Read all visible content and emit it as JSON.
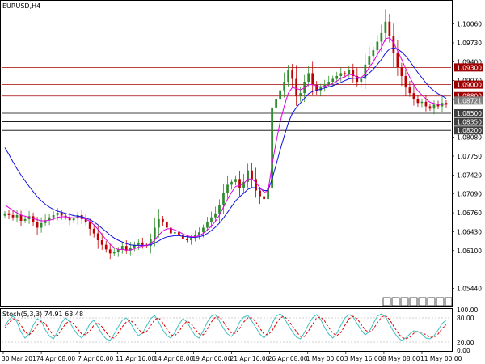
{
  "window": {
    "title": "EURUSD,H4"
  },
  "colors": {
    "bull": "#2e8b2e",
    "bear": "#c00000",
    "ma_fast": "#e000e0",
    "ma_slow": "#1010e0",
    "resistance": "#a00000",
    "support": "#000000",
    "stoch_main": "#40c0c0",
    "stoch_signal": "#e00000",
    "grid": "#c0c0c0"
  },
  "chart_data": [
    {
      "type": "candlestick",
      "title": "EURUSD,H4",
      "ylim": [
        1.0515,
        1.1045
      ],
      "y_ticks": [
        "1.10060",
        "1.09730",
        "1.09400",
        "1.09070",
        "1.08740",
        "1.08080",
        "1.07750",
        "1.07420",
        "1.07090",
        "1.06760",
        "1.06430",
        "1.06100",
        "1.05440"
      ],
      "x_ticks": [
        "30 Mar 2017",
        "4 Apr 08:00",
        "7 Apr 00:00",
        "11 Apr 16:00",
        "14 Apr 08:00",
        "19 Apr 00:00",
        "21 Apr 16:00",
        "26 Apr 08:00",
        "1 May 00:00",
        "3 May 16:00",
        "8 May 08:00",
        "11 May 00:00"
      ],
      "series": [
        {
          "name": "close",
          "values": [
            1.0675,
            1.0672,
            1.0668,
            1.0672,
            1.0662,
            1.0665,
            1.067,
            1.066,
            1.065,
            1.0658,
            1.0663,
            1.0668,
            1.0672,
            1.0676,
            1.0671,
            1.0668,
            1.0663,
            1.0666,
            1.0672,
            1.0665,
            1.0659,
            1.0648,
            1.064,
            1.0628,
            1.062,
            1.0612,
            1.0605,
            1.0608,
            1.0612,
            1.0618,
            1.061,
            1.0615,
            1.062,
            1.0624,
            1.062,
            1.0618,
            1.063,
            1.065,
            1.0665,
            1.066,
            1.065,
            1.064,
            1.0642,
            1.0638,
            1.063,
            1.0628,
            1.0632,
            1.0638,
            1.0642,
            1.065,
            1.066,
            1.0668,
            1.0675,
            1.069,
            1.071,
            1.0725,
            1.073,
            1.0735,
            1.072,
            1.073,
            1.075,
            1.0735,
            1.0715,
            1.0705,
            1.07,
            1.072,
            1.086,
            1.0875,
            1.089,
            1.0905,
            1.0925,
            1.091,
            1.088,
            1.0885,
            1.0905,
            1.092,
            1.09,
            1.089,
            1.0895,
            1.09,
            1.0905,
            1.091,
            1.0915,
            1.092,
            1.0918,
            1.0925,
            1.0915,
            1.0905,
            1.091,
            1.0935,
            1.095,
            1.096,
            1.0975,
            1.099,
            1.101,
            1.0985,
            1.0955,
            1.093,
            1.0915,
            1.0895,
            1.0885,
            1.0875,
            1.0868,
            1.087,
            1.0862,
            1.0858,
            1.0865,
            1.0862,
            1.0868,
            1.0865
          ]
        },
        {
          "name": "MA fast",
          "values": [
            1.069,
            1.0685,
            1.068,
            1.0676,
            1.0672,
            1.067,
            1.0668,
            1.0666,
            1.0664,
            1.0662,
            1.0662,
            1.0663,
            1.0665,
            1.0668,
            1.0669,
            1.0669,
            1.0668,
            1.0667,
            1.0668,
            1.0667,
            1.0665,
            1.0661,
            1.0655,
            1.0647,
            1.0638,
            1.0629,
            1.0621,
            1.0615,
            1.0612,
            1.0612,
            1.0611,
            1.0611,
            1.0613,
            1.0616,
            1.0618,
            1.0619,
            1.0622,
            1.0628,
            1.0637,
            1.0644,
            1.0648,
            1.0648,
            1.0646,
            1.0643,
            1.0639,
            1.0636,
            1.0634,
            1.0634,
            1.0636,
            1.064,
            1.0646,
            1.0653,
            1.0661,
            1.0672,
            1.0686,
            1.07,
            1.0712,
            1.0722,
            1.0724,
            1.0727,
            1.0735,
            1.0735,
            1.0729,
            1.072,
            1.0712,
            1.0714,
            1.076,
            1.08,
            1.0835,
            1.0862,
            1.0885,
            1.0895,
            1.0893,
            1.0891,
            1.0894,
            1.09,
            1.09,
            1.0897,
            1.0896,
            1.0897,
            1.0899,
            1.0902,
            1.0906,
            1.0911,
            1.0914,
            1.0918,
            1.0917,
            1.0913,
            1.0912,
            1.0919,
            1.093,
            1.094,
            1.0952,
            1.0965,
            1.098,
            1.0982,
            1.0973,
            1.0959,
            1.0944,
            1.0928,
            1.0913,
            1.09,
            1.0889,
            1.0882,
            1.0875,
            1.0869,
            1.0867,
            1.0865,
            1.0866,
            1.0866
          ]
        },
        {
          "name": "MA slow",
          "values": [
            1.079,
            1.0778,
            1.0765,
            1.0753,
            1.0742,
            1.0732,
            1.0722,
            1.0713,
            1.0704,
            1.0697,
            1.0691,
            1.0686,
            1.0682,
            1.0679,
            1.0677,
            1.0675,
            1.0673,
            1.0671,
            1.067,
            1.0669,
            1.0667,
            1.0664,
            1.066,
            1.0655,
            1.0649,
            1.0643,
            1.0637,
            1.0632,
            1.0628,
            1.0625,
            1.0622,
            1.062,
            1.0619,
            1.0619,
            1.0619,
            1.0619,
            1.062,
            1.0623,
            1.0627,
            1.0631,
            1.0634,
            1.0635,
            1.0636,
            1.0636,
            1.0635,
            1.0634,
            1.0633,
            1.0633,
            1.0634,
            1.0636,
            1.064,
            1.0645,
            1.0651,
            1.0658,
            1.0667,
            1.0677,
            1.0687,
            1.0697,
            1.0704,
            1.071,
            1.0717,
            1.072,
            1.072,
            1.0718,
            1.0715,
            1.0715,
            1.0735,
            1.076,
            1.0786,
            1.081,
            1.0833,
            1.085,
            1.086,
            1.0868,
            1.0876,
            1.0884,
            1.0888,
            1.089,
            1.0892,
            1.0894,
            1.0896,
            1.0898,
            1.0901,
            1.0904,
            1.0907,
            1.091,
            1.0911,
            1.0911,
            1.0911,
            1.0914,
            1.092,
            1.0927,
            1.0935,
            1.0944,
            1.0955,
            1.0962,
            1.0964,
            1.0962,
            1.0957,
            1.095,
            1.0941,
            1.0931,
            1.0921,
            1.0912,
            1.0903,
            1.0895,
            1.0889,
            1.0884,
            1.088,
            1.0876
          ]
        }
      ],
      "levels": [
        {
          "value": 1.093,
          "label": "1.09300",
          "kind": "resistance"
        },
        {
          "value": 1.09,
          "label": "1.09000",
          "kind": "resistance"
        },
        {
          "value": 1.088,
          "label": "1.08800",
          "kind": "resistance"
        },
        {
          "value": 1.085,
          "label": "1.08500",
          "kind": "support"
        },
        {
          "value": 1.0835,
          "label": "1.08350",
          "kind": "support"
        },
        {
          "value": 1.082,
          "label": "1.08200",
          "kind": "support"
        }
      ],
      "current_price": "1.08721"
    },
    {
      "type": "line",
      "title": "Stoch(5,3,3) 74.91 63.48",
      "ylim": [
        0,
        100
      ],
      "y_ticks": [
        "100.00",
        "80.00",
        "20.00",
        "0.00"
      ],
      "series": [
        {
          "name": "Stoch main",
          "values": [
            60,
            75,
            85,
            70,
            45,
            30,
            40,
            62,
            78,
            72,
            50,
            35,
            28,
            45,
            68,
            80,
            70,
            52,
            38,
            30,
            45,
            66,
            74,
            58,
            40,
            28,
            24,
            40,
            58,
            74,
            80,
            68,
            50,
            36,
            42,
            60,
            78,
            86,
            70,
            50,
            36,
            30,
            44,
            64,
            78,
            70,
            52,
            36,
            30,
            48,
            70,
            84,
            88,
            72,
            54,
            40,
            34,
            48,
            70,
            82,
            86,
            72,
            56,
            40,
            30,
            44,
            66,
            84,
            90,
            80,
            62,
            46,
            32,
            28,
            44,
            64,
            80,
            88,
            76,
            56,
            40,
            30,
            42,
            62,
            80,
            88,
            82,
            66,
            50,
            38,
            46,
            66,
            84,
            90,
            82,
            64,
            46,
            32,
            24,
            30,
            40,
            48,
            46,
            40,
            30,
            28,
            36,
            50,
            66,
            75
          ]
        },
        {
          "name": "Stoch signal",
          "values": [
            55,
            68,
            78,
            76,
            62,
            45,
            38,
            48,
            62,
            72,
            66,
            50,
            36,
            36,
            50,
            66,
            72,
            66,
            52,
            40,
            38,
            48,
            62,
            68,
            58,
            44,
            32,
            30,
            42,
            58,
            70,
            74,
            66,
            52,
            42,
            46,
            60,
            76,
            80,
            68,
            52,
            38,
            36,
            46,
            62,
            72,
            66,
            52,
            40,
            38,
            52,
            70,
            82,
            82,
            70,
            54,
            42,
            42,
            54,
            70,
            80,
            80,
            70,
            54,
            40,
            38,
            48,
            66,
            80,
            84,
            74,
            60,
            46,
            34,
            34,
            48,
            64,
            80,
            82,
            72,
            56,
            42,
            36,
            44,
            62,
            78,
            84,
            78,
            64,
            50,
            44,
            52,
            68,
            82,
            86,
            76,
            60,
            44,
            32,
            28,
            32,
            42,
            46,
            44,
            38,
            32,
            32,
            40,
            54,
            63
          ]
        }
      ]
    }
  ]
}
